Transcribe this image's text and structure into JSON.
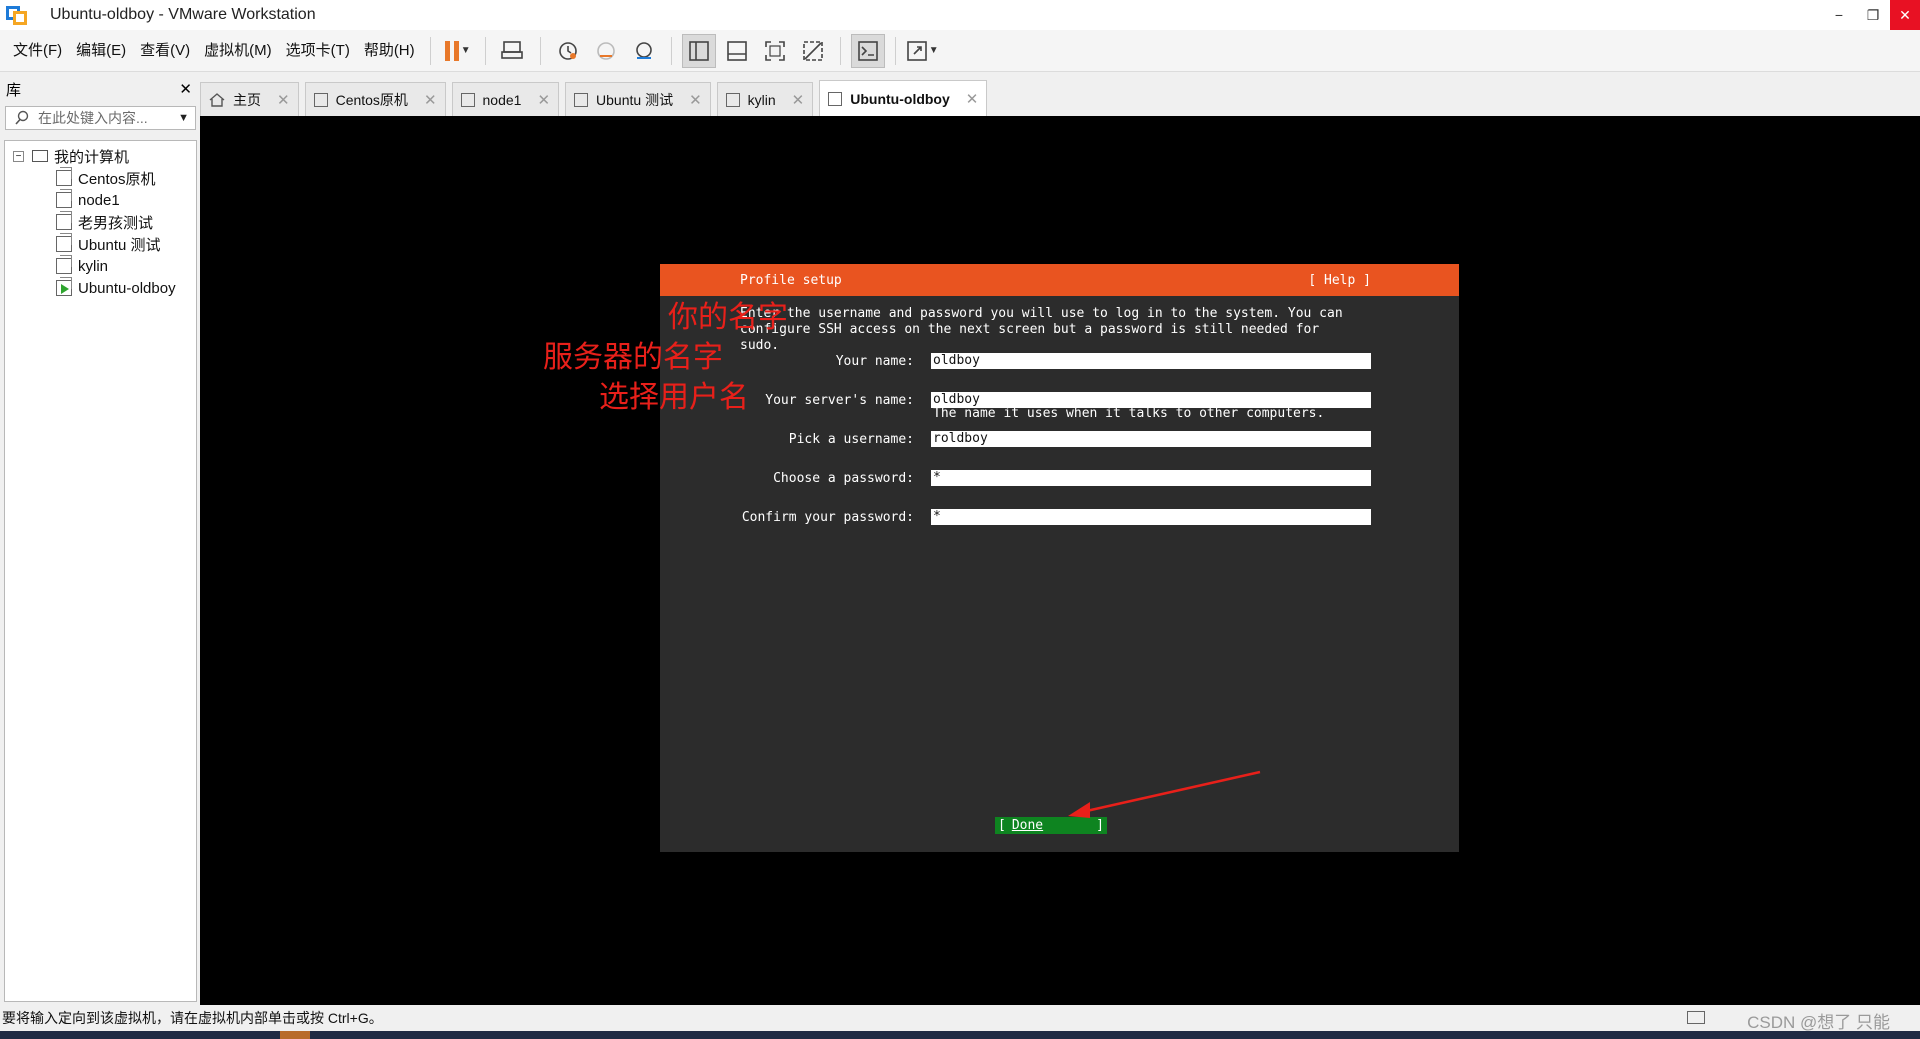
{
  "window": {
    "title": "Ubuntu-oldboy - VMware Workstation",
    "minimize": "−",
    "restore": "❐",
    "close": "✕"
  },
  "menu": [
    "文件(F)",
    "编辑(E)",
    "查看(V)",
    "虚拟机(M)",
    "选项卡(T)",
    "帮助(H)"
  ],
  "toolbar": {
    "icons": [
      "pause-icon",
      "send-ctrl-alt-del-icon",
      "snapshot-icon",
      "revert-snapshot-icon",
      "snapshot-manager-icon",
      "library-view-icon",
      "thumbnail-view-icon",
      "fullscreen-icon",
      "unity-icon",
      "console-icon",
      "stretch-icon"
    ],
    "accent": "#e8782a"
  },
  "library": {
    "title": "库",
    "close": "✕",
    "search_placeholder": "在此处键入内容...",
    "root": "我的计算机",
    "items": [
      "Centos原机",
      "node1",
      "老男孩测试",
      "Ubuntu 测试",
      "kylin",
      "Ubuntu-oldboy"
    ],
    "running_item": "Ubuntu-oldboy"
  },
  "tabs": [
    {
      "label": "主页",
      "icon": "home-icon"
    },
    {
      "label": "Centos原机",
      "icon": "vm-icon"
    },
    {
      "label": "node1",
      "icon": "vm-icon"
    },
    {
      "label": "Ubuntu 测试",
      "icon": "vm-icon"
    },
    {
      "label": "kylin",
      "icon": "vm-icon"
    },
    {
      "label": "Ubuntu-oldboy",
      "icon": "vm-running-icon",
      "active": true
    }
  ],
  "installer": {
    "header_color": "#e95420",
    "title": "Profile setup",
    "help": "[ Help ]",
    "description": "Enter the username and password you will use to log in to the system. You can\nconfigure SSH access on the next screen but a password is still needed for\nsudo.",
    "fields": {
      "name_label": "Your name:",
      "name_value": "oldboy",
      "server_label": "Your server's name:",
      "server_value": "oldboy",
      "server_hint": "The name it uses when it talks to other computers.",
      "username_label": "Pick a username:",
      "username_value": "roldboy",
      "password_label": "Choose a password:",
      "password_value": "*",
      "confirm_label": "Confirm your password:",
      "confirm_value": "*"
    },
    "done_open": "[",
    "done_label": "Done",
    "done_close": "]",
    "done_color": "#0e8420"
  },
  "annotations": {
    "name": "你的名字",
    "server": "服务器的名字",
    "username": "选择用户名",
    "color": "#e8201a"
  },
  "status": {
    "message": "要将输入定向到该虚拟机，请在虚拟机内部单击或按 Ctrl+G。",
    "watermark": "CSDN @想了 只能"
  }
}
